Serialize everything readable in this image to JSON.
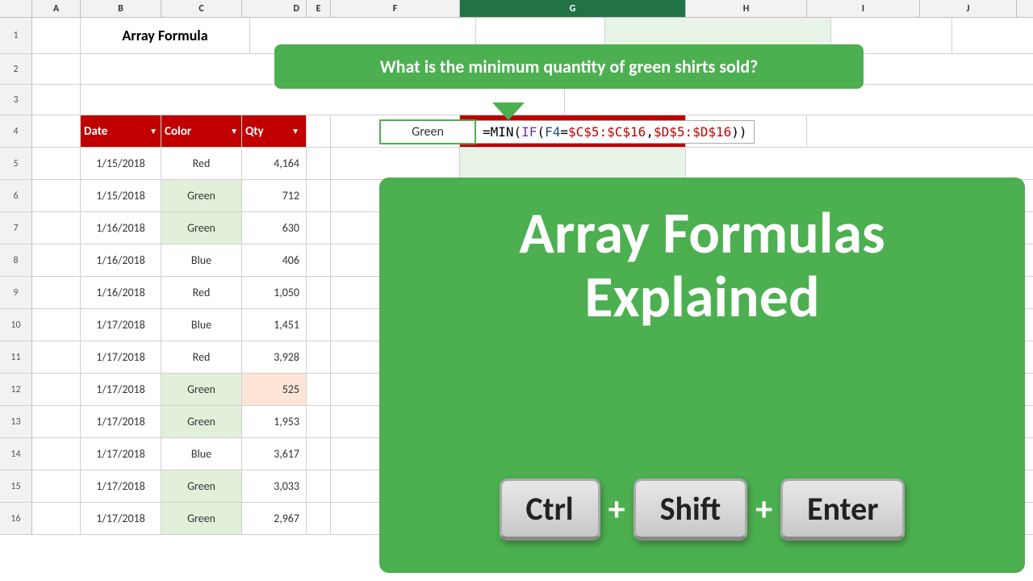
{
  "title": "Array Formula",
  "callout": {
    "question": "What is the minimum quantity of green shirts sold?"
  },
  "formula": {
    "input_cell": "Green",
    "formula_text": "=MIN(IF(F4=$C$5:$C$16,$D$5:$D$16))"
  },
  "panel": {
    "title_line1": "Array Formulas",
    "title_line2": "Explained",
    "key1": "Ctrl",
    "key2": "Shift",
    "key3": "Enter",
    "plus": "+"
  },
  "columns": {
    "headers": [
      "A",
      "B",
      "C",
      "D",
      "E",
      "F",
      "G",
      "H",
      "I",
      "J"
    ]
  },
  "table": {
    "headers": {
      "date": "Date",
      "color": "Color",
      "qty": "Qty"
    },
    "rows": [
      {
        "row": 5,
        "date": "1/15/2018",
        "color": "Red",
        "qty": "4,164",
        "green": false
      },
      {
        "row": 6,
        "date": "1/15/2018",
        "color": "Green",
        "qty": "712",
        "green": true
      },
      {
        "row": 7,
        "date": "1/16/2018",
        "color": "Green",
        "qty": "630",
        "green": true
      },
      {
        "row": 8,
        "date": "1/16/2018",
        "color": "Blue",
        "qty": "406",
        "green": false
      },
      {
        "row": 9,
        "date": "1/16/2018",
        "color": "Red",
        "qty": "1,050",
        "green": false
      },
      {
        "row": 10,
        "date": "1/17/2018",
        "color": "Blue",
        "qty": "1,451",
        "green": false
      },
      {
        "row": 11,
        "date": "1/17/2018",
        "color": "Red",
        "qty": "3,928",
        "green": false
      },
      {
        "row": 12,
        "date": "1/17/2018",
        "color": "Green",
        "qty": "525",
        "green": true,
        "highlight": true
      },
      {
        "row": 13,
        "date": "1/17/2018",
        "color": "Green",
        "qty": "1,953",
        "green": true
      },
      {
        "row": 14,
        "date": "1/17/2018",
        "color": "Blue",
        "qty": "3,617",
        "green": false
      },
      {
        "row": 15,
        "date": "1/17/2018",
        "color": "Green",
        "qty": "3,033",
        "green": true
      },
      {
        "row": 16,
        "date": "1/17/2018",
        "color": "Green",
        "qty": "2,967",
        "green": true
      }
    ]
  }
}
